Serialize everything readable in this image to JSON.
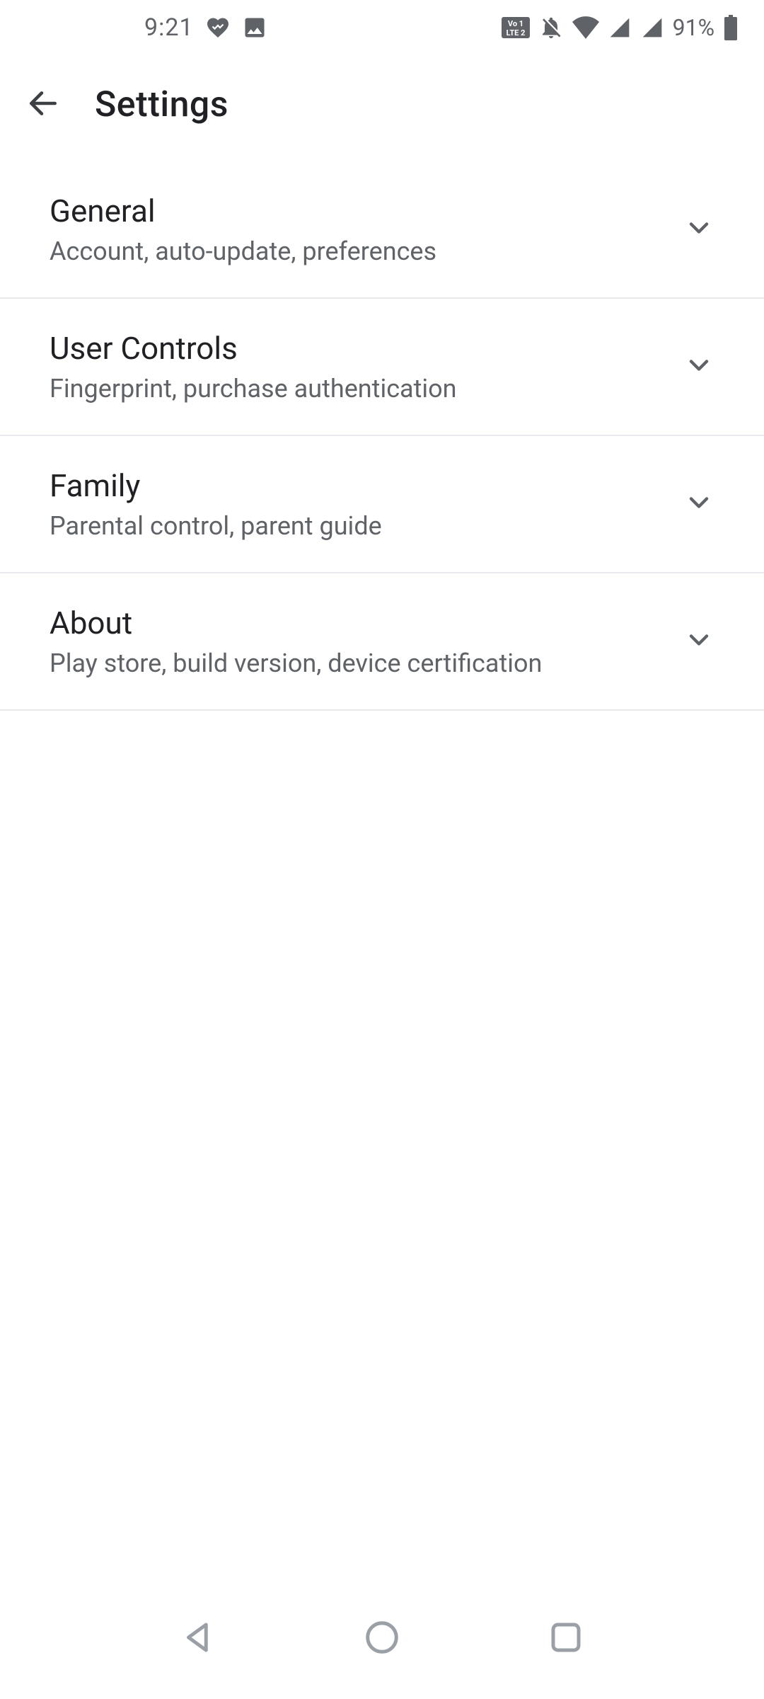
{
  "status_bar": {
    "time": "9:21",
    "battery_pct": "91%"
  },
  "header": {
    "title": "Settings"
  },
  "settings": [
    {
      "title": "General",
      "subtitle": "Account, auto-update, preferences"
    },
    {
      "title": "User Controls",
      "subtitle": "Fingerprint, purchase authentication"
    },
    {
      "title": "Family",
      "subtitle": "Parental control, parent guide"
    },
    {
      "title": "About",
      "subtitle": "Play store, build version, device certification"
    }
  ]
}
